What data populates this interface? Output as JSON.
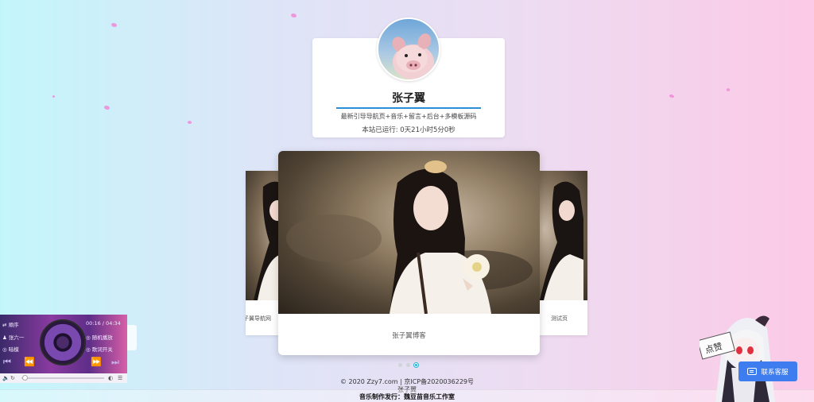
{
  "profile": {
    "name": "张子翼",
    "description": "最新引导导航页+音乐+留言+后台+多模板源码",
    "runtime": "本站已运行: 0天21小时5分0秒"
  },
  "carousel": {
    "left_caption": "张子翼导航网",
    "main_caption": "张子翼博客",
    "right_caption": "测试页",
    "active_index": 2
  },
  "footer": {
    "line1": "© 2020 Zzy7.com | 京ICP备2020036229号",
    "line2": "张子翼",
    "line3": "音乐制作发行：魏豆苗音乐工作室"
  },
  "player": {
    "mode_left": "⇄ 顺序",
    "time": "00:16 / 04:34",
    "user_label": "张六一",
    "random_label": "随机播放",
    "mode_label2": "暗模",
    "lyrics_label": "歌词开关"
  },
  "mascot": {
    "sign_text": "点赞"
  },
  "service": {
    "label": "联系客服"
  },
  "colors": {
    "accent": "#2b8fd8",
    "active_dot": "#27b3cf",
    "service_button": "#3d7df0"
  }
}
